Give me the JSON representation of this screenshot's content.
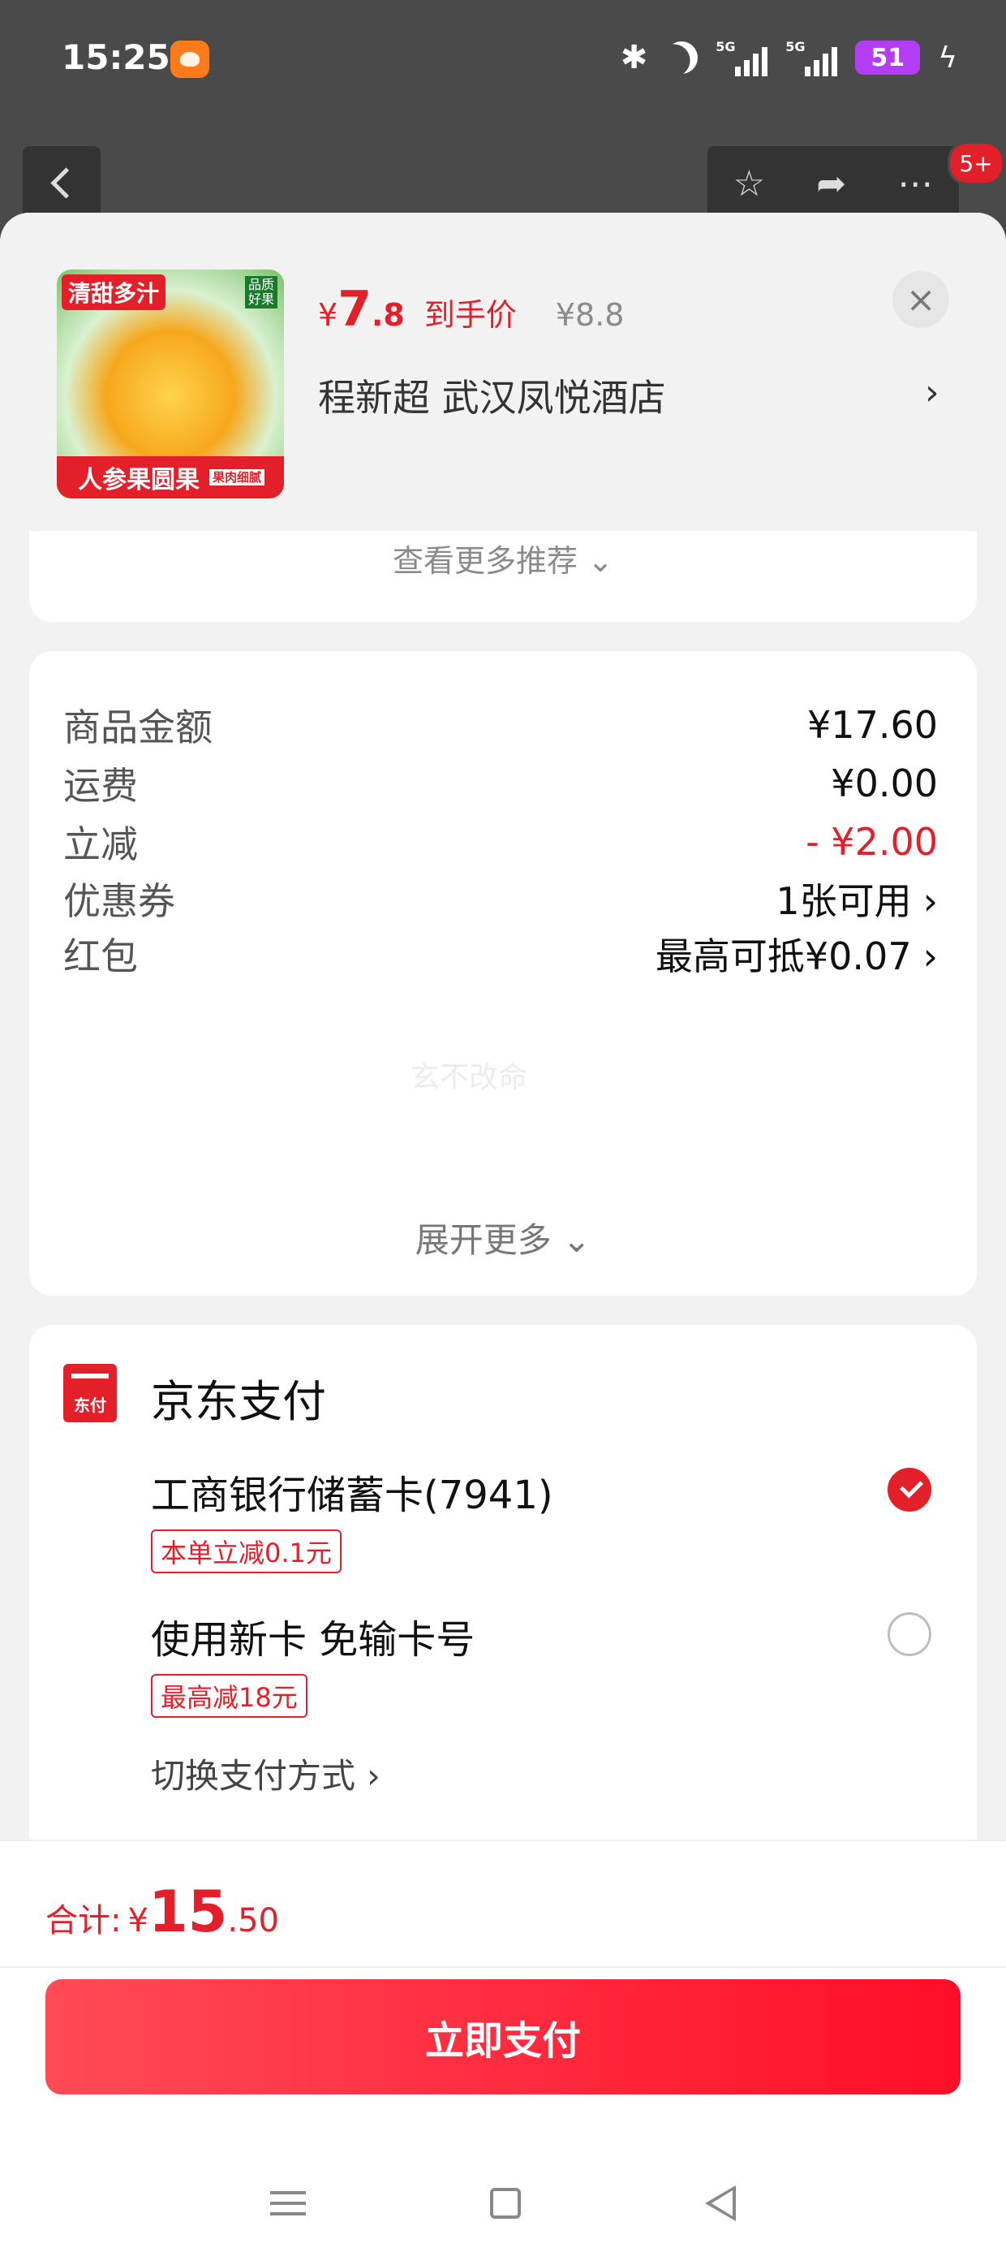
{
  "status_bar": {
    "time": "15:25",
    "signal1": "5G",
    "signal2": "5G",
    "battery": "51"
  },
  "top_badge": "5+",
  "product": {
    "image_tag": "清甜多汁",
    "image_tag2": "品质好果",
    "image_banner": "人参果圆果",
    "image_banner_small": "果肉细腻",
    "price_symbol": "¥",
    "price_int": "7",
    "price_dec": ".8",
    "price_label": "到手价",
    "original_price": "¥8.8",
    "store": "程新超  武汉凤悦酒店",
    "close": "×"
  },
  "recommend": {
    "see_more": "查看更多推荐 ⌄"
  },
  "summary": {
    "rows": [
      {
        "label": "商品金额",
        "value": "¥17.60"
      },
      {
        "label": "运费",
        "value": "¥0.00"
      },
      {
        "label": "立减",
        "value": "- ¥2.00"
      },
      {
        "label": "优惠券",
        "value": "1张可用"
      },
      {
        "label": "红包",
        "value": "最高可抵¥0.07"
      }
    ],
    "watermark": "玄不改命",
    "expand_more": "展开更多 ⌄"
  },
  "payment": {
    "logo_text": "东付",
    "title": "京东支付",
    "methods": [
      {
        "name": "工商银行储蓄卡(7941)",
        "tag": "本单立减0.1元",
        "selected": true
      },
      {
        "name": "使用新卡 免输卡号",
        "tag": "最高减18元",
        "selected": false
      }
    ],
    "switch_label": "切换支付方式"
  },
  "footer": {
    "total_label": "合计:",
    "total_symbol": "¥",
    "total_int": "15",
    "total_dec": ".50",
    "pay_button": "立即支付"
  },
  "colors": {
    "accent": "#e3202a",
    "battery": "#b33cf5"
  },
  "icons": [
    "back-icon",
    "star-icon",
    "share-icon",
    "more-icon",
    "close-icon",
    "chevron-right-icon",
    "checkmark-icon",
    "bluetooth-icon",
    "moon-icon",
    "battery-icon",
    "charging-icon",
    "menu-icon",
    "home-icon",
    "back-nav-icon"
  ]
}
